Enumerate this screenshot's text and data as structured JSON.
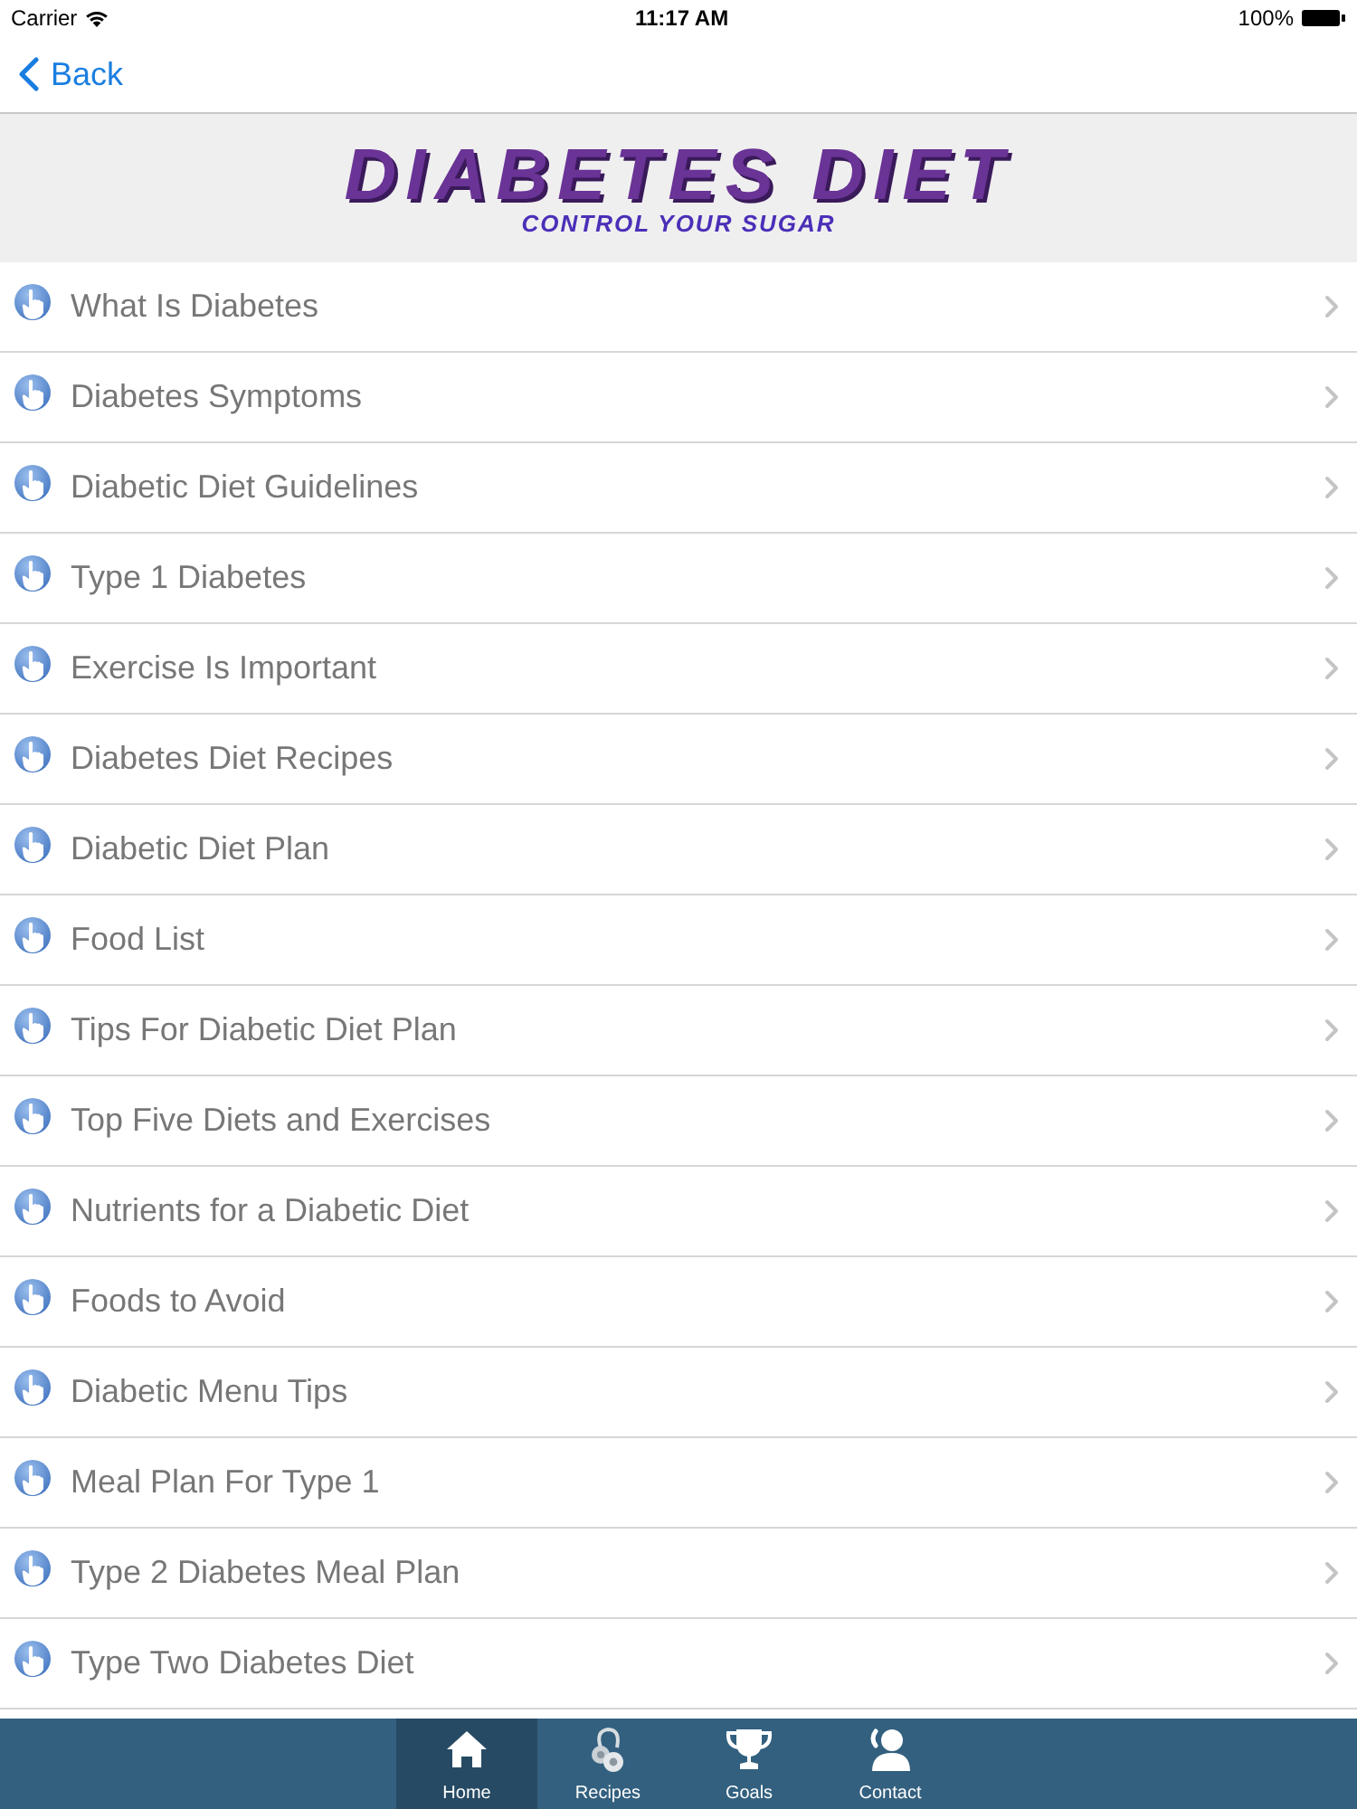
{
  "status_bar": {
    "carrier": "Carrier",
    "time": "11:17 AM",
    "battery": "100%"
  },
  "nav_bar": {
    "back_label": "Back"
  },
  "banner": {
    "title": "DIABETES DIET",
    "subtitle": "CONTROL YOUR SUGAR"
  },
  "list": {
    "items": [
      "What Is Diabetes",
      "Diabetes Symptoms",
      "Diabetic Diet Guidelines",
      "Type 1 Diabetes",
      "Exercise Is Important",
      "Diabetes Diet Recipes",
      "Diabetic Diet Plan",
      "Food List",
      "Tips For Diabetic Diet Plan",
      "Top Five Diets and Exercises",
      "Nutrients for a Diabetic Diet",
      "Foods to Avoid",
      "Diabetic Menu Tips",
      "Meal Plan For Type 1",
      "Type 2 Diabetes Meal Plan",
      "Type Two Diabetes Diet"
    ]
  },
  "tab_bar": {
    "tabs": [
      {
        "kind": "home",
        "label": "Home",
        "selected": true
      },
      {
        "kind": "recipes",
        "label": "Recipes",
        "selected": false
      },
      {
        "kind": "goals",
        "label": "Goals",
        "selected": false
      },
      {
        "kind": "contact",
        "label": "Contact",
        "selected": false
      }
    ]
  }
}
